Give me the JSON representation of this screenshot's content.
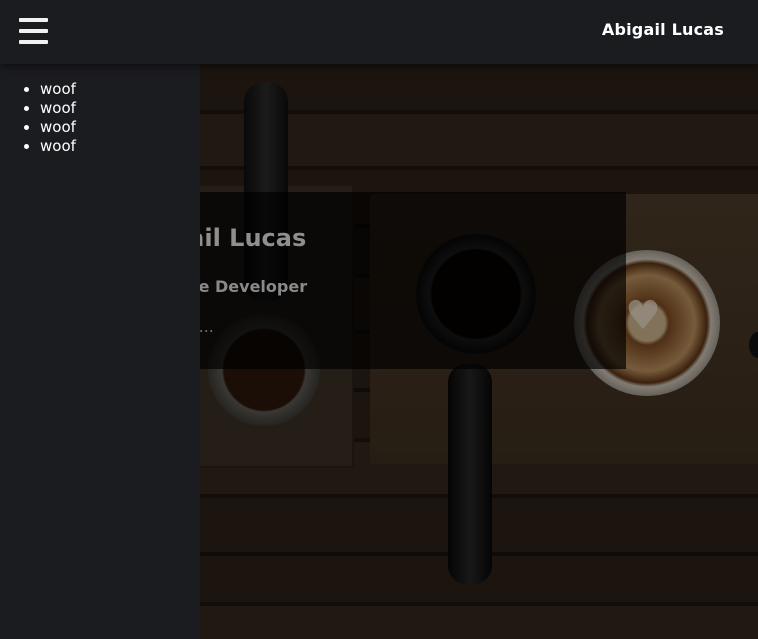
{
  "header": {
    "site_name": "Abigail Lucas",
    "menu_icon": "hamburger-menu-icon"
  },
  "sidebar": {
    "items": [
      {
        "label": "woof"
      },
      {
        "label": "woof"
      },
      {
        "label": "woof"
      },
      {
        "label": "woof"
      }
    ]
  },
  "hero": {
    "title": "Abigail Lucas",
    "subtitle": "Software Developer",
    "text": "I do stuff..."
  },
  "colors": {
    "topbar": "#1b1c20",
    "sidebar": "#1b1c20",
    "text_primary": "#ffffff",
    "card_overlay": "rgba(0,0,0,0.68)"
  }
}
